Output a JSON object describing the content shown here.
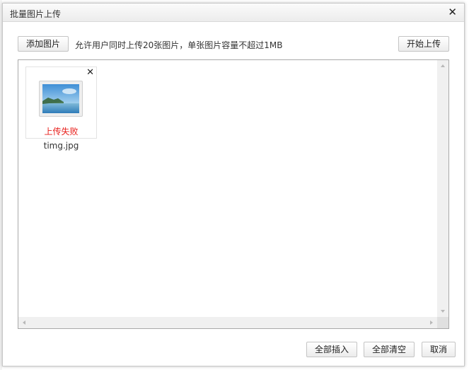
{
  "dialog": {
    "title": "批量图片上传",
    "close_icon": "close-icon"
  },
  "toolbar": {
    "add_label": "添加图片",
    "hint": "允许用户同时上传20张图片，单张图片容量不超过1MB",
    "start_label": "开始上传"
  },
  "files": [
    {
      "name": "timg.jpg",
      "status": "上传失败",
      "thumbnail": "landscape-image-icon",
      "remove_icon": "close-icon"
    }
  ],
  "footer": {
    "insert_all_label": "全部插入",
    "clear_all_label": "全部清空",
    "cancel_label": "取消"
  },
  "colors": {
    "error": "#e8201c",
    "border": "#a9a9a9",
    "titlebar": "#f2f2f2"
  }
}
